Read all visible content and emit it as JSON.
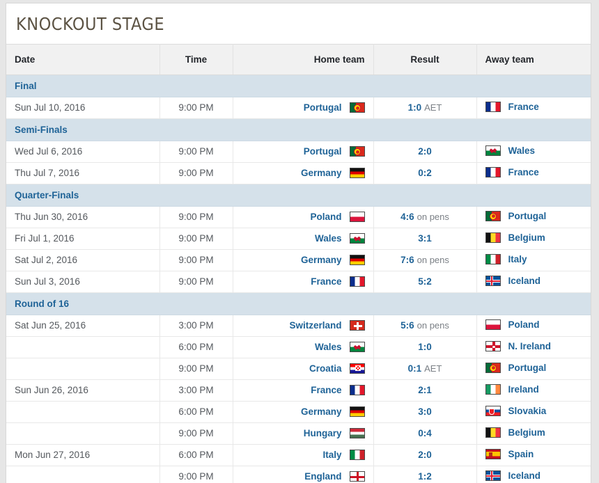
{
  "page": {
    "title": "KNOCKOUT STAGE",
    "background": "#e6e6e6",
    "accent_blue": "#1f6397",
    "section_bg": "#d5e1ea",
    "winner_bg": "#fdf3da"
  },
  "columns": {
    "date": "Date",
    "time": "Time",
    "home": "Home team",
    "result": "Result",
    "away": "Away team"
  },
  "sections": [
    {
      "label": "Final",
      "matches": [
        {
          "date": "Sun Jul 10, 2016",
          "time": "9:00 PM",
          "home": "Portugal",
          "home_flag": "portugal",
          "home_win": true,
          "score": "1:0",
          "suffix": "AET",
          "away": "France",
          "away_flag": "france",
          "away_win": false
        }
      ]
    },
    {
      "label": "Semi-Finals",
      "matches": [
        {
          "date": "Wed Jul 6, 2016",
          "time": "9:00 PM",
          "home": "Portugal",
          "home_flag": "portugal",
          "home_win": true,
          "score": "2:0",
          "suffix": "",
          "away": "Wales",
          "away_flag": "wales",
          "away_win": false
        },
        {
          "date": "Thu Jul 7, 2016",
          "time": "9:00 PM",
          "home": "Germany",
          "home_flag": "germany",
          "home_win": false,
          "score": "0:2",
          "suffix": "",
          "away": "France",
          "away_flag": "france",
          "away_win": true
        }
      ]
    },
    {
      "label": "Quarter-Finals",
      "matches": [
        {
          "date": "Thu Jun 30, 2016",
          "time": "9:00 PM",
          "home": "Poland",
          "home_flag": "poland",
          "home_win": false,
          "score": "4:6",
          "suffix": "on pens",
          "away": "Portugal",
          "away_flag": "portugal",
          "away_win": true
        },
        {
          "date": "Fri Jul 1, 2016",
          "time": "9:00 PM",
          "home": "Wales",
          "home_flag": "wales",
          "home_win": true,
          "score": "3:1",
          "suffix": "",
          "away": "Belgium",
          "away_flag": "belgium",
          "away_win": false
        },
        {
          "date": "Sat Jul 2, 2016",
          "time": "9:00 PM",
          "home": "Germany",
          "home_flag": "germany",
          "home_win": true,
          "score": "7:6",
          "suffix": "on pens",
          "away": "Italy",
          "away_flag": "italy",
          "away_win": false
        },
        {
          "date": "Sun Jul 3, 2016",
          "time": "9:00 PM",
          "home": "France",
          "home_flag": "france",
          "home_win": true,
          "score": "5:2",
          "suffix": "",
          "away": "Iceland",
          "away_flag": "iceland",
          "away_win": false
        }
      ]
    },
    {
      "label": "Round of 16",
      "matches": [
        {
          "date": "Sat Jun 25, 2016",
          "time": "3:00 PM",
          "home": "Switzerland",
          "home_flag": "switzerland",
          "home_win": false,
          "score": "5:6",
          "suffix": "on pens",
          "away": "Poland",
          "away_flag": "poland",
          "away_win": true
        },
        {
          "date": "",
          "time": "6:00 PM",
          "home": "Wales",
          "home_flag": "wales",
          "home_win": true,
          "score": "1:0",
          "suffix": "",
          "away": "N. Ireland",
          "away_flag": "nireland",
          "away_win": false
        },
        {
          "date": "",
          "time": "9:00 PM",
          "home": "Croatia",
          "home_flag": "croatia",
          "home_win": false,
          "score": "0:1",
          "suffix": "AET",
          "away": "Portugal",
          "away_flag": "portugal",
          "away_win": true
        },
        {
          "date": "Sun Jun 26, 2016",
          "time": "3:00 PM",
          "home": "France",
          "home_flag": "france",
          "home_win": true,
          "score": "2:1",
          "suffix": "",
          "away": "Ireland",
          "away_flag": "ireland",
          "away_win": false
        },
        {
          "date": "",
          "time": "6:00 PM",
          "home": "Germany",
          "home_flag": "germany",
          "home_win": true,
          "score": "3:0",
          "suffix": "",
          "away": "Slovakia",
          "away_flag": "slovakia",
          "away_win": false
        },
        {
          "date": "",
          "time": "9:00 PM",
          "home": "Hungary",
          "home_flag": "hungary",
          "home_win": false,
          "score": "0:4",
          "suffix": "",
          "away": "Belgium",
          "away_flag": "belgium",
          "away_win": true
        },
        {
          "date": "Mon Jun 27, 2016",
          "time": "6:00 PM",
          "home": "Italy",
          "home_flag": "italy",
          "home_win": true,
          "score": "2:0",
          "suffix": "",
          "away": "Spain",
          "away_flag": "spain",
          "away_win": false
        },
        {
          "date": "",
          "time": "9:00 PM",
          "home": "England",
          "home_flag": "england",
          "home_win": false,
          "score": "1:2",
          "suffix": "",
          "away": "Iceland",
          "away_flag": "iceland",
          "away_win": true
        }
      ]
    }
  ]
}
